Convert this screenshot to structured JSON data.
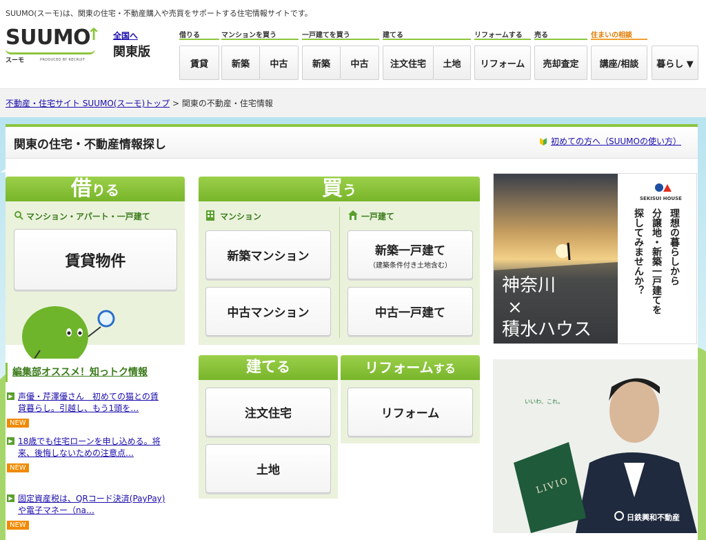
{
  "header": {
    "tagline": "SUUMO(スーモ)は、関東の住宅・不動産購入や売買をサポートする住宅情報サイトです。",
    "logo_text": "SUUMO",
    "logo_kana": "スーモ",
    "logo_produced": "PRODUCED BY RECRUIT",
    "region_link": "全国へ",
    "region_name": "関東版"
  },
  "nav": [
    {
      "label": "借りる",
      "buttons": [
        "賃貸"
      ]
    },
    {
      "label": "マンションを買う",
      "buttons": [
        "新築",
        "中古"
      ]
    },
    {
      "label": "一戸建てを買う",
      "buttons": [
        "新築",
        "中古"
      ]
    },
    {
      "label": "建てる",
      "buttons": [
        "注文住宅",
        "土地"
      ]
    },
    {
      "label": "リフォームする",
      "buttons": [
        "リフォーム"
      ]
    },
    {
      "label": "売る",
      "buttons": [
        "売却査定"
      ]
    },
    {
      "label": "住まいの相談",
      "buttons": [
        "講座/相談"
      ]
    },
    {
      "label": "",
      "buttons": [
        "暮らし ▼"
      ]
    }
  ],
  "breadcrumb": {
    "link": "不動産・住宅サイト SUUMO(スーモ)トップ",
    "separator": " > ",
    "current": "関東の不動産・住宅情報"
  },
  "panel": {
    "title": "関東の住宅・不動産情報探し",
    "help_link": "初めての方へ（SUUMOの使い方）"
  },
  "rent": {
    "banner_main": "借",
    "banner_sub": "りる",
    "subhead": "マンション・アパート・一戸建て",
    "card": "賃貸物件"
  },
  "buy": {
    "banner_main": "買",
    "banner_sub": "う",
    "mansion_head": "マンション",
    "house_head": "一戸建て",
    "cards": {
      "new_mansion": "新築マンション",
      "used_mansion": "中古マンション",
      "new_house": "新築一戸建て",
      "new_house_note": "（建築条件付き土地含む）",
      "used_house": "中古一戸建て"
    }
  },
  "build": {
    "banner_main": "建て",
    "banner_sub": "る",
    "cards": {
      "custom": "注文住宅",
      "land": "土地"
    }
  },
  "reform": {
    "banner_main": "リフォーム",
    "banner_sub": "する",
    "card": "リフォーム"
  },
  "recommend": {
    "title": "編集部オススメ！知っトク情報",
    "items": [
      {
        "text": "声優・芹澤優さん　初めての猫との賃貸暮らし。引越し、もう1頭を…",
        "badge": "NEW"
      },
      {
        "text": "18歳でも住宅ローンを申し込める。将来、後悔しないための注意点…",
        "badge": "NEW"
      },
      {
        "text": "固定資産税は、QRコード決済(PayPay)や電子マネー（na…",
        "badge": "NEW"
      }
    ]
  },
  "ads": {
    "ad1": {
      "brand": "SEKISUI HOUSE",
      "vertical_lines": [
        "理想の暮らしから",
        "分譲地・新築一戸建てを",
        "探してみませんか？"
      ],
      "place": "神奈川",
      "cross": "×",
      "company": "積水ハウス"
    },
    "ad2": {
      "tagline": "いいわ、これ。",
      "book": "LIVIO",
      "company": "日鉄興和不動産"
    }
  },
  "colors": {
    "brand_green": "#8cc63f",
    "link": "#1a0dab",
    "new_badge": "#f08a00"
  }
}
